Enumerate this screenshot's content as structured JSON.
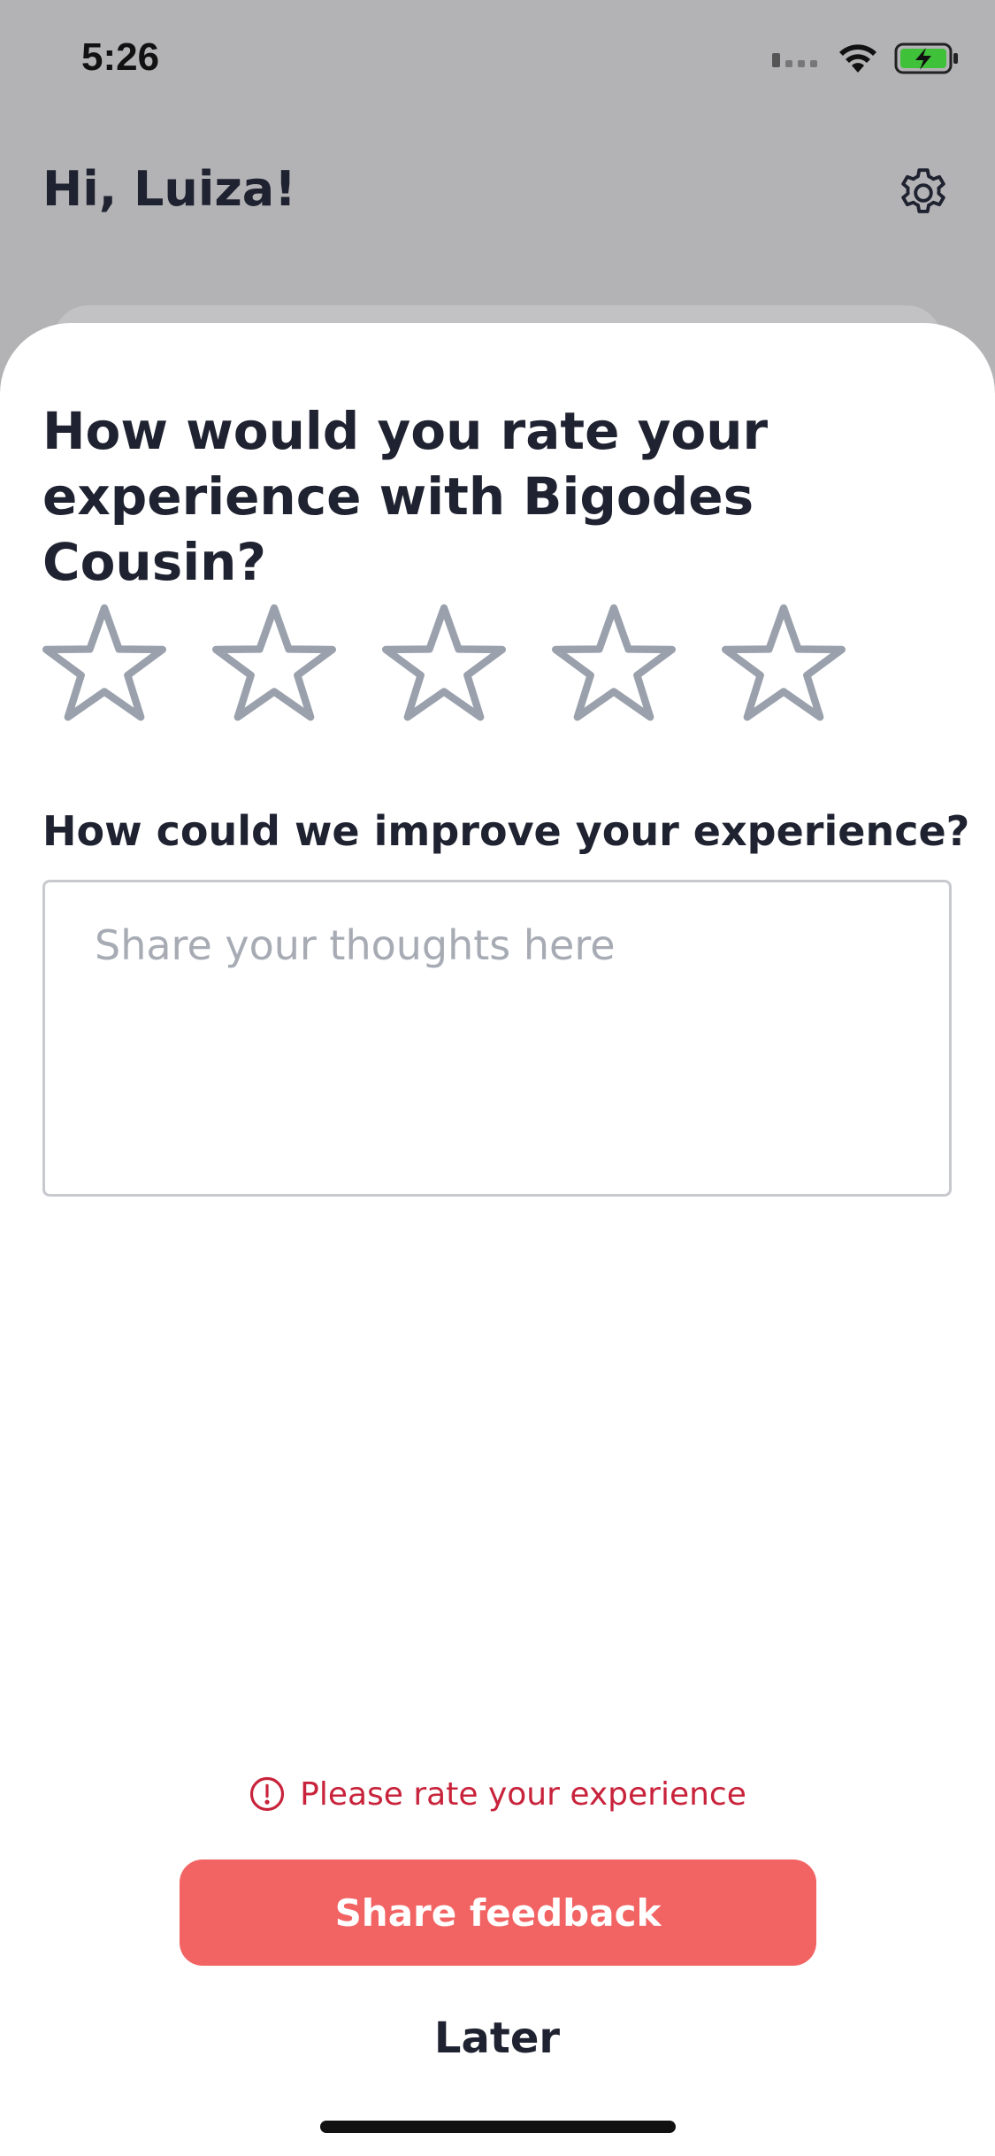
{
  "status_bar": {
    "time": "5:26",
    "icons": [
      "signal-icon",
      "wifi-icon",
      "battery-charging-icon"
    ]
  },
  "header": {
    "greeting": "Hi, Luiza!",
    "settings_icon": "gear-icon"
  },
  "rating": {
    "title": "How would you rate your experience with Bigodes Cousin?",
    "max_stars": 5,
    "selected_stars": 0,
    "star_color": "#9aa1ad"
  },
  "improve": {
    "label": "How could we improve your experience?",
    "placeholder": "Share your thoughts here",
    "value": ""
  },
  "error": {
    "icon": "alert-circle-icon",
    "message": "Please rate your experience",
    "color": "#c8233b"
  },
  "actions": {
    "share_label": "Share feedback",
    "share_color": "#f26363",
    "later_label": "Later"
  }
}
